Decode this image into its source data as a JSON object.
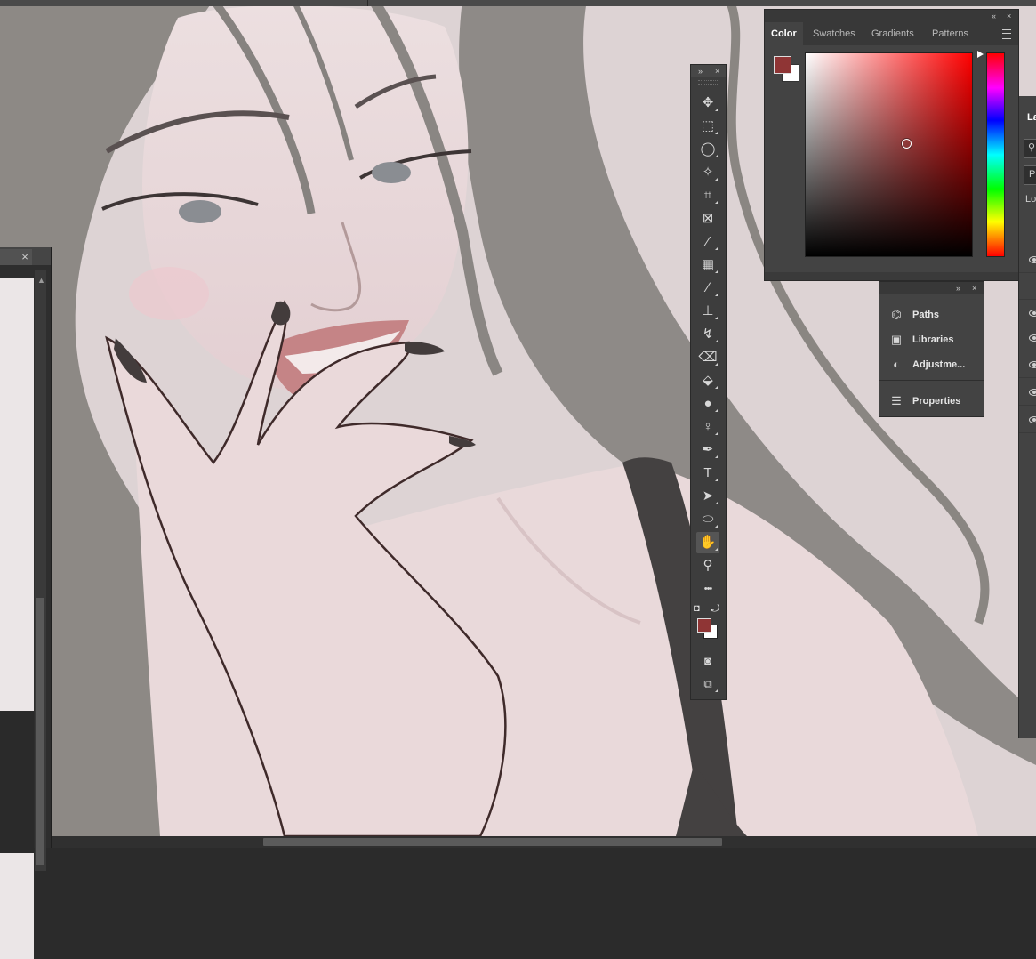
{
  "colors": {
    "foreground": "#8f3535",
    "background": "#ffffff",
    "accent": "#ff0000",
    "panel_bg": "#434343",
    "canvas_bg": "#ddd3d3"
  },
  "left_panel": {
    "close_icon": "×",
    "scroll_up": "▲"
  },
  "toolbar": {
    "collapse": "»",
    "close": "×",
    "tools": [
      {
        "name": "move-tool-icon",
        "glyph": "✥"
      },
      {
        "name": "rectangular-marquee-tool-icon",
        "glyph": "⬚"
      },
      {
        "name": "lasso-tool-icon",
        "glyph": "◯"
      },
      {
        "name": "magic-wand-tool-icon",
        "glyph": "✧"
      },
      {
        "name": "crop-tool-icon",
        "glyph": "⌗"
      },
      {
        "name": "frame-tool-icon",
        "glyph": "⊠"
      },
      {
        "name": "eyedropper-tool-icon",
        "glyph": "⁄"
      },
      {
        "name": "spot-healing-brush-icon",
        "glyph": "▦"
      },
      {
        "name": "brush-tool-icon",
        "glyph": "∕"
      },
      {
        "name": "clone-stamp-tool-icon",
        "glyph": "⊥"
      },
      {
        "name": "history-brush-tool-icon",
        "glyph": "↯"
      },
      {
        "name": "eraser-tool-icon",
        "glyph": "⌫"
      },
      {
        "name": "paint-bucket-tool-icon",
        "glyph": "⬙"
      },
      {
        "name": "blur-tool-icon",
        "glyph": "●"
      },
      {
        "name": "dodge-tool-icon",
        "glyph": "♀"
      },
      {
        "name": "pen-tool-icon",
        "glyph": "✒"
      },
      {
        "name": "type-tool-icon",
        "glyph": "T"
      },
      {
        "name": "path-selection-tool-icon",
        "glyph": "➤"
      },
      {
        "name": "ellipse-tool-icon",
        "glyph": "⬭"
      },
      {
        "name": "hand-tool-icon",
        "glyph": "✋"
      },
      {
        "name": "zoom-tool-icon",
        "glyph": "⚲"
      },
      {
        "name": "edit-toolbar-icon",
        "glyph": "•••"
      }
    ],
    "default_colors_icon": "◘",
    "swap_colors_icon": "⤾",
    "quick_mask_icon": "◙",
    "screen_mode_icon": "⧉"
  },
  "color_panel": {
    "collapse": "«",
    "close": "×",
    "tabs": [
      "Color",
      "Swatches",
      "Gradients",
      "Patterns"
    ],
    "selected_tab": "Color"
  },
  "small_panel": {
    "collapse": "»",
    "close": "×",
    "items": [
      {
        "label": "Paths",
        "icon": "⌬"
      },
      {
        "label": "Libraries",
        "icon": "▣"
      },
      {
        "label": "Adjustme...",
        "icon": "◐"
      },
      {
        "label": "Properties",
        "icon": "☰"
      }
    ]
  },
  "layers_panel": {
    "title": "La",
    "search_icon": "⚲",
    "kind_prefix": "P",
    "lock_label": "Lo"
  }
}
